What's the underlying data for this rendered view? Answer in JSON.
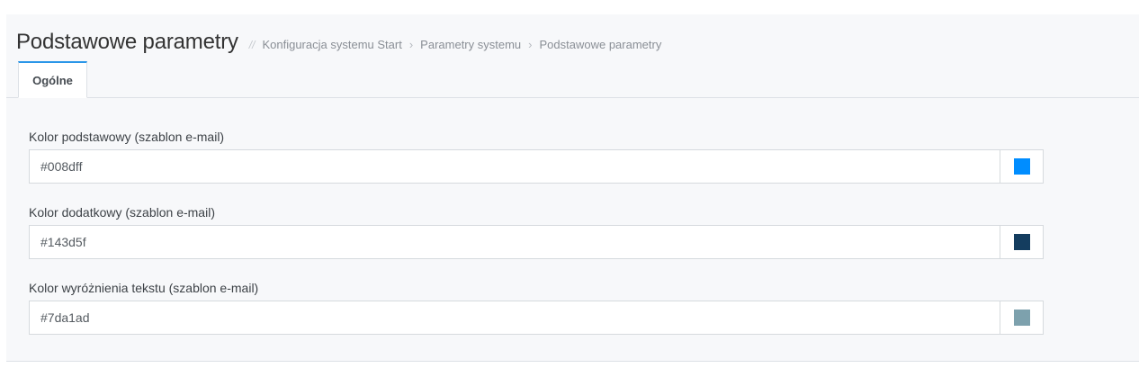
{
  "header": {
    "title": "Podstawowe parametry",
    "breadcrumb_separator": "//",
    "breadcrumb": [
      "Konfiguracja systemu Start",
      "Parametry systemu",
      "Podstawowe parametry"
    ],
    "breadcrumb_arrow": "›"
  },
  "tabs": [
    {
      "label": "Ogólne",
      "active": true
    }
  ],
  "fields": [
    {
      "label": "Kolor podstawowy (szablon e-mail)",
      "value": "#008dff",
      "swatch_color": "#008dff"
    },
    {
      "label": "Kolor dodatkowy (szablon e-mail)",
      "value": "#143d5f",
      "swatch_color": "#143d5f"
    },
    {
      "label": "Kolor wyróżnienia tekstu (szablon e-mail)",
      "value": "#7da1ad",
      "swatch_color": "#7da1ad"
    }
  ],
  "colors": {
    "tab_accent": "#2a96e8",
    "panel_background": "#f7f8fa"
  }
}
